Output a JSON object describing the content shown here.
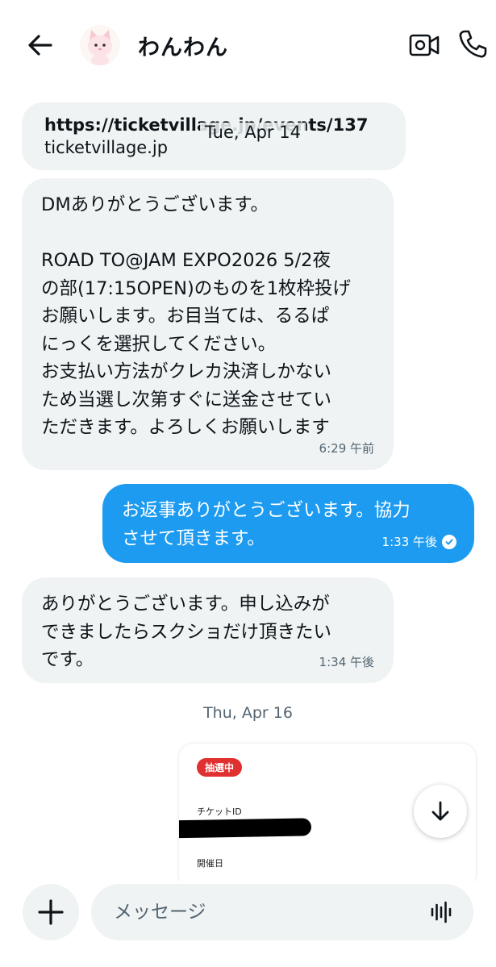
{
  "header": {
    "back_icon": "arrow-left-icon",
    "contact_name": "わんわん",
    "avatar_icon": "cat-plush-avatar",
    "video_icon": "video-camera-icon",
    "call_icon": "phone-icon"
  },
  "messages": {
    "link": {
      "url": "https://ticketvillage.jp/events/137...",
      "domain": "ticketvillage.jp"
    },
    "date_overlay": "Tue, Apr 14",
    "m1": {
      "text": "DMありがとうございます。\n\nROAD TO@JAM EXPO2026 5/2夜\nの部(17:15OPEN)のものを1枚枠投げ\nお願いします。お目当ては、るるぱ\nにっくを選択してください。\nお支払い方法がクレカ決済しかない\nため当選し次第すぐに送金させてい\nただきます。よろしくお願いします",
      "time": "6:29 午前"
    },
    "m2": {
      "text": "お返事ありがとうございます。協力\nさせて頂きます。",
      "time": "1:33 午後",
      "status_icon": "read-check-icon"
    },
    "m3": {
      "text": "ありがとうございます。申し込みが\nできましたらスクショだけ頂きたい\nです。",
      "time": "1:34 午後"
    },
    "date_separator": "Thu, Apr 16",
    "image_card": {
      "badge": "抽選中",
      "ticket_id_label": "チケットID",
      "event_date_label": "開催日"
    }
  },
  "scroll_down_icon": "arrow-down-icon",
  "composer": {
    "add_icon": "plus-icon",
    "placeholder": "メッセージ",
    "voice_icon": "voice-wave-icon"
  },
  "colors": {
    "accent": "#1d9bf0",
    "incoming_bubble": "#eff3f4",
    "badge_red": "#e0302f"
  }
}
